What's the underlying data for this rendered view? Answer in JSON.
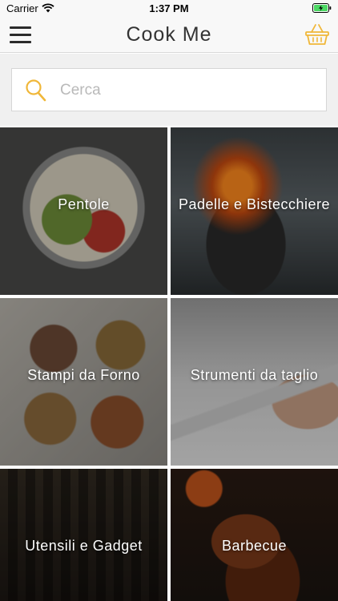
{
  "status_bar": {
    "carrier": "Carrier",
    "time": "1:37 PM"
  },
  "nav": {
    "title": "Cook Me",
    "menu_icon": "hamburger-menu-icon",
    "cart_icon": "shopping-basket-icon",
    "accent_color": "#f0b739"
  },
  "search": {
    "placeholder": "Cerca",
    "value": "",
    "icon": "search-icon"
  },
  "categories": [
    {
      "label": "Pentole"
    },
    {
      "label": "Padelle e Bistecchiere"
    },
    {
      "label": "Stampi da Forno"
    },
    {
      "label": "Strumenti da taglio"
    },
    {
      "label": "Utensili e Gadget"
    },
    {
      "label": "Barbecue"
    }
  ]
}
